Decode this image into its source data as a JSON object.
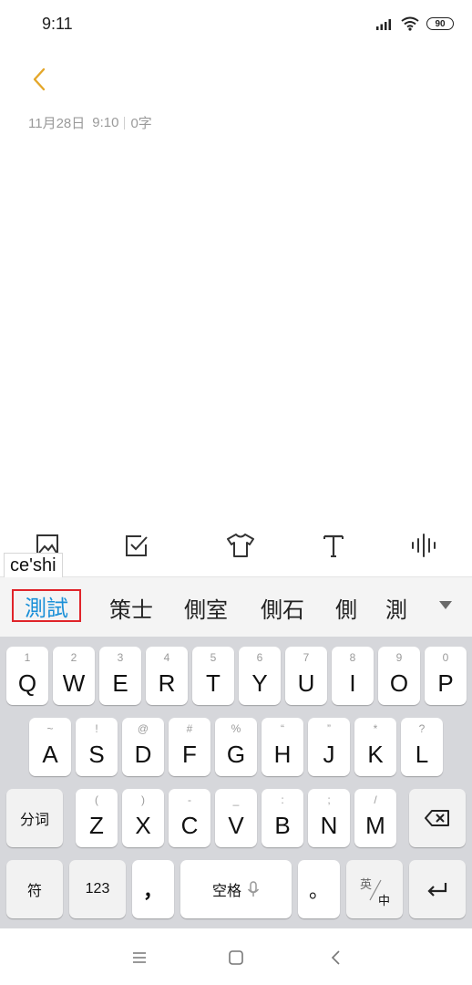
{
  "status": {
    "time": "9:11",
    "battery": "90"
  },
  "note": {
    "date": "11月28日",
    "time": "9:10",
    "count": "0字"
  },
  "ime": {
    "pinyin": "ce'shi",
    "candidates": [
      "測試",
      "策士",
      "側室",
      "側石",
      "側",
      "測"
    ]
  },
  "keyboard": {
    "row1": [
      {
        "hint": "1",
        "key": "Q"
      },
      {
        "hint": "2",
        "key": "W"
      },
      {
        "hint": "3",
        "key": "E"
      },
      {
        "hint": "4",
        "key": "R"
      },
      {
        "hint": "5",
        "key": "T"
      },
      {
        "hint": "6",
        "key": "Y"
      },
      {
        "hint": "7",
        "key": "U"
      },
      {
        "hint": "8",
        "key": "I"
      },
      {
        "hint": "9",
        "key": "O"
      },
      {
        "hint": "0",
        "key": "P"
      }
    ],
    "row2": [
      {
        "hint": "~",
        "key": "A"
      },
      {
        "hint": "!",
        "key": "S"
      },
      {
        "hint": "@",
        "key": "D"
      },
      {
        "hint": "#",
        "key": "F"
      },
      {
        "hint": "%",
        "key": "G"
      },
      {
        "hint": "“",
        "key": "H"
      },
      {
        "hint": "”",
        "key": "J"
      },
      {
        "hint": "*",
        "key": "K"
      },
      {
        "hint": "?",
        "key": "L"
      }
    ],
    "row3": [
      {
        "hint": "(",
        "key": "Z"
      },
      {
        "hint": ")",
        "key": "X"
      },
      {
        "hint": "-",
        "key": "C"
      },
      {
        "hint": "_",
        "key": "V"
      },
      {
        "hint": ":",
        "key": "B"
      },
      {
        "hint": ";",
        "key": "N"
      },
      {
        "hint": "/",
        "key": "M"
      }
    ],
    "segment_label": "分词",
    "symbol_label": "符",
    "num_label": "123",
    "comma_label": "，",
    "space_label": "空格",
    "period_label": "。",
    "lang_top": "英",
    "lang_bottom": "中"
  }
}
